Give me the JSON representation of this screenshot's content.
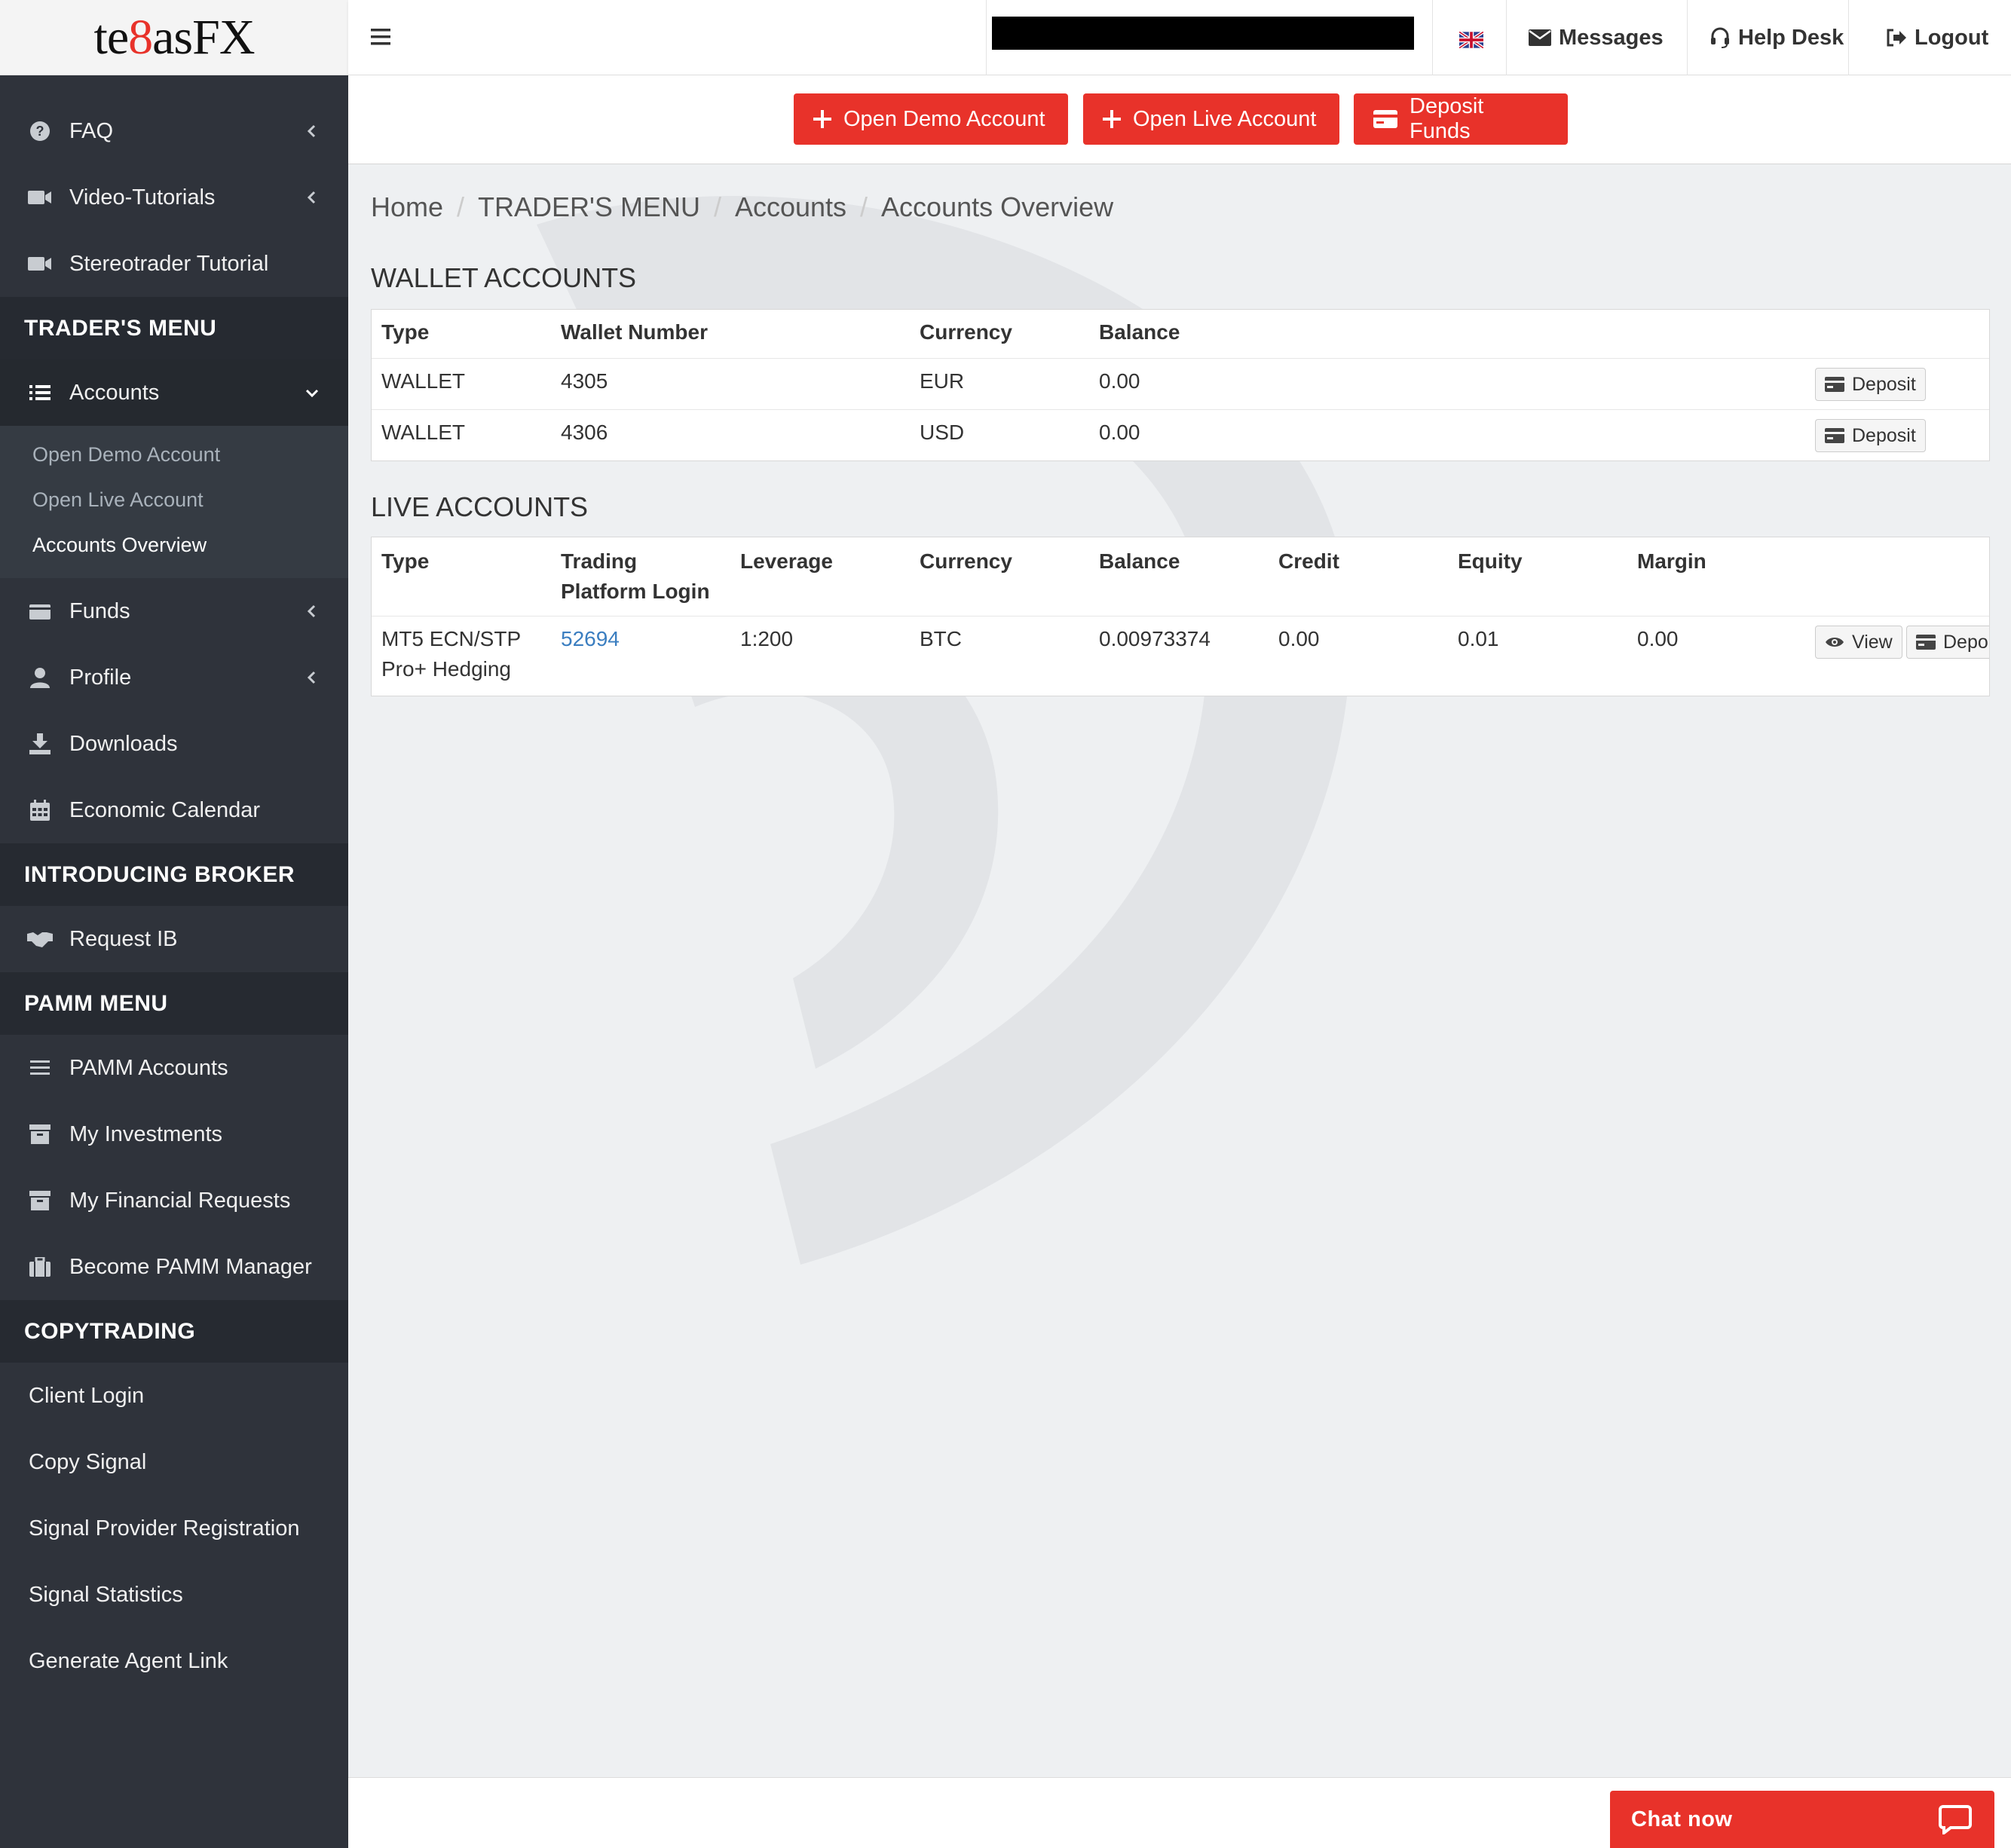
{
  "logo": {
    "part1": "te",
    "part2": "8",
    "part3": "asFX"
  },
  "topbar": {
    "messages": "Messages",
    "helpdesk": "Help Desk",
    "logout": "Logout"
  },
  "actions": {
    "open_demo": "Open Demo Account",
    "open_live": "Open Live Account",
    "deposit_funds": "Deposit Funds"
  },
  "sidebar": {
    "faq": "FAQ",
    "video": "Video-Tutorials",
    "stereotrader": "Stereotrader Tutorial",
    "traders_menu": "TRADER'S MENU",
    "accounts": "Accounts",
    "accounts_sub": [
      "Open Demo Account",
      "Open Live Account",
      "Accounts Overview"
    ],
    "funds": "Funds",
    "profile": "Profile",
    "downloads": "Downloads",
    "calendar": "Economic Calendar",
    "introducing_broker": "INTRODUCING BROKER",
    "request_ib": "Request IB",
    "pamm_menu": "PAMM MENU",
    "pamm_accounts": "PAMM Accounts",
    "my_investments": "My Investments",
    "my_financial_requests": "My Financial Requests",
    "become_pamm": "Become PAMM Manager",
    "copytrading": "COPYTRADING",
    "client_login": "Client Login",
    "copy_signal": "Copy Signal",
    "signal_provider": "Signal Provider Registration",
    "signal_statistics": "Signal Statistics",
    "agent_link": "Generate Agent Link"
  },
  "breadcrumb": [
    "Home",
    "TRADER'S MENU",
    "Accounts",
    "Accounts Overview"
  ],
  "wallet": {
    "title": "WALLET ACCOUNTS",
    "headers": [
      "Type",
      "Wallet Number",
      "Currency",
      "Balance"
    ],
    "rows": [
      {
        "type": "WALLET",
        "number": "4305",
        "currency": "EUR",
        "balance": "0.00",
        "action": "Deposit"
      },
      {
        "type": "WALLET",
        "number": "4306",
        "currency": "USD",
        "balance": "0.00",
        "action": "Deposit"
      }
    ]
  },
  "live": {
    "title": "LIVE ACCOUNTS",
    "headers": {
      "type": "Type",
      "login_1": "Trading",
      "login_2": "Platform Login",
      "leverage": "Leverage",
      "currency": "Currency",
      "balance": "Balance",
      "credit": "Credit",
      "equity": "Equity",
      "margin": "Margin"
    },
    "rows": [
      {
        "type_1": "MT5 ECN/STP",
        "type_2": "Pro+ Hedging",
        "login": "52694",
        "leverage": "1:200",
        "currency": "BTC",
        "balance": "0.00973374",
        "credit": "0.00",
        "equity": "0.01",
        "margin": "0.00",
        "view": "View",
        "deposit": "Depo"
      }
    ]
  },
  "chat": {
    "label": "Chat now"
  },
  "colors": {
    "accent": "#e8322a",
    "sidebar": "#2f333b",
    "link": "#3b7ec0"
  }
}
